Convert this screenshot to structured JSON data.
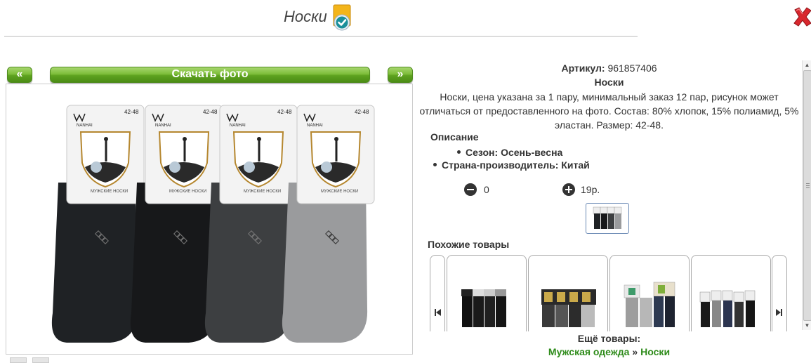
{
  "header": {
    "title": "Носки",
    "verified_icon": "check-badge-icon",
    "close_icon": "red-x-close-icon"
  },
  "gallery": {
    "prev_label": "«",
    "next_label": "»",
    "download_label": "Скачать фото",
    "sock_colors": [
      "#1f2225",
      "#17181a",
      "#3d3f41",
      "#9a9b9d"
    ],
    "package_text": {
      "brand": "NANHAI",
      "size": "42-48",
      "caption": "МУЖСКИЕ НОСКИ"
    }
  },
  "product": {
    "article_label": "Артикул:",
    "article_value": "961857406",
    "name": "Носки",
    "description_lines": [
      "Носки, цена указана за 1 пару, минимальный заказ 12 пар, рисунок может",
      "отличаться от предоставленного на фото. Состав: 80% хлопок, 15% полиамид, 5%",
      "эластан. Размер: 42-48."
    ],
    "description_title": "Описание",
    "specs": [
      "Сезон: Осень-весна",
      "Страна-производитель: Китай"
    ],
    "quantity": "0",
    "price": "19р."
  },
  "similar": {
    "title": "Похожие товары",
    "prev_icon": "skip-prev-icon",
    "next_icon": "skip-next-icon"
  },
  "more": {
    "title": "Ещё товары:",
    "crumbs": [
      "Мужская одежда",
      "Носки"
    ],
    "separator": "»"
  },
  "colors": {
    "accent_green": "#5ea21f",
    "link_green": "#2e8b1a",
    "close_red": "#d8272d"
  }
}
